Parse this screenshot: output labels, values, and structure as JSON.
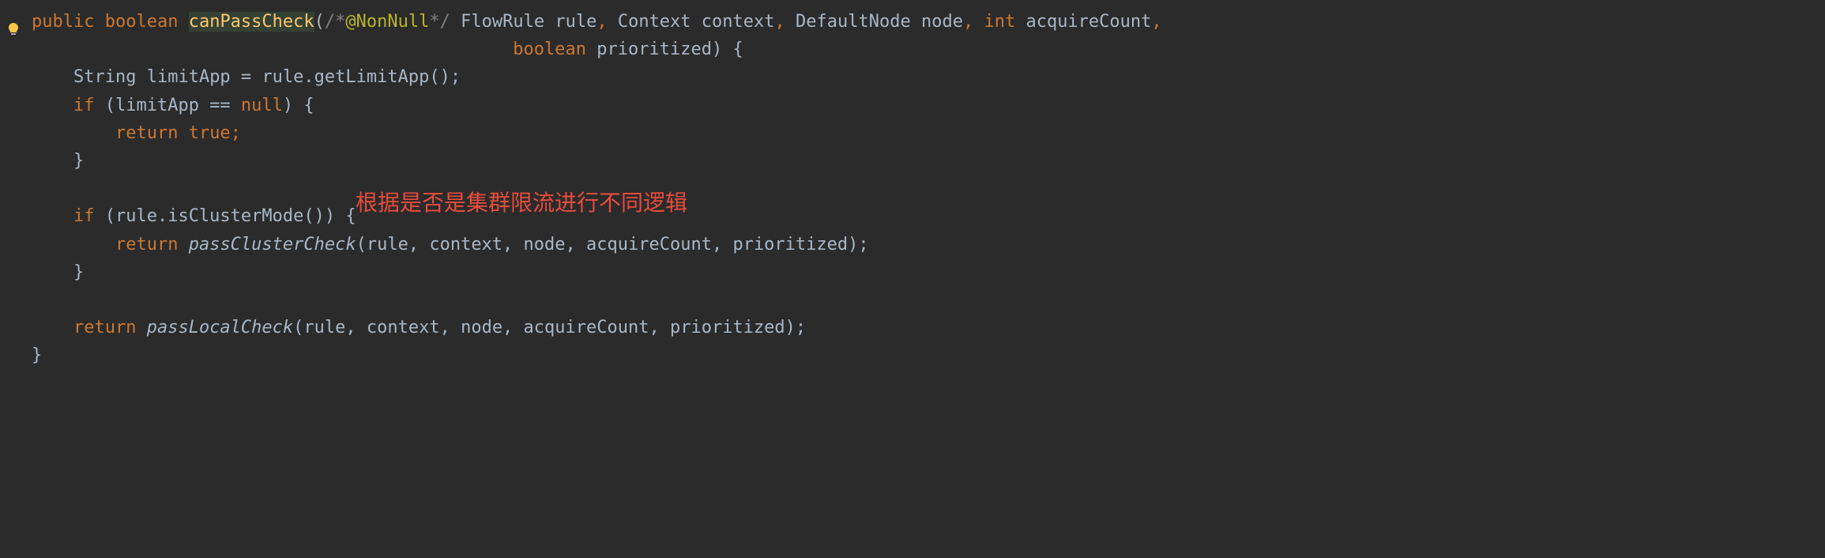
{
  "code": {
    "line1": {
      "public": "public",
      "boolean": "boolean",
      "methodName": "canPassCheck",
      "paren_open": "(",
      "comment_open": "/*",
      "annotation": "@NonNull",
      "comment_close": "*/",
      "param1_type": "FlowRule",
      "param1_name": "rule",
      "comma1": ",",
      "param2_type": "Context",
      "param2_name": "context",
      "comma2": ",",
      "param3_type": "DefaultNode",
      "param3_name": "node",
      "comma3": ",",
      "param4_type": "int",
      "param4_name": "acquireCount",
      "comma4": ","
    },
    "line2": {
      "param5_type": "boolean",
      "param5_name": "prioritized",
      "paren_close": ")",
      "brace_open": " {"
    },
    "line3": {
      "type": "String",
      "var": "limitApp",
      "assign": " = ",
      "call": "rule.getLimitApp();"
    },
    "line4": {
      "if_kw": "if",
      "cond_open": " (limitApp == ",
      "null_kw": "null",
      "cond_close": ") {"
    },
    "line5": {
      "return_kw": "return",
      "true_kw": " true",
      "semi": ";"
    },
    "line6": {
      "brace_close": "}"
    },
    "line8": {
      "if_kw": "if",
      "cond": " (rule.isClusterMode()) {"
    },
    "line9": {
      "return_kw": "return",
      "space": " ",
      "method": "passClusterCheck",
      "args": "(rule, context, node, acquireCount, prioritized);"
    },
    "line10": {
      "brace_close": "}"
    },
    "line12": {
      "return_kw": "return",
      "space": " ",
      "method": "passLocalCheck",
      "args": "(rule, context, node, acquireCount, prioritized);"
    },
    "line13": {
      "brace_close": "}"
    }
  },
  "annotation": "根据是否是集群限流进行不同逻辑"
}
